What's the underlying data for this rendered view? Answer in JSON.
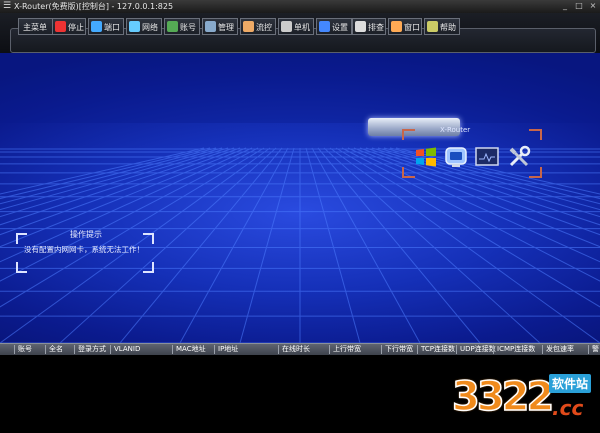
{
  "window": {
    "title": "X-Router(免费版)[控制台] - 127.0.0.1:825",
    "menu_icon": "menu-icon",
    "minimize_glyph": "_",
    "maximize_glyph": "□",
    "close_glyph": "×"
  },
  "toolbar": {
    "items": [
      {
        "label": "主菜单",
        "icon": "none"
      },
      {
        "label": "停止",
        "icon": "stop-icon"
      },
      {
        "label": "端口",
        "icon": "port-icon"
      },
      {
        "label": "网络",
        "icon": "network-icon"
      },
      {
        "label": "账号",
        "icon": "account-icon"
      },
      {
        "label": "管理",
        "icon": "manage-icon"
      },
      {
        "label": "流控",
        "icon": "flow-icon"
      },
      {
        "label": "单机",
        "icon": "host-icon"
      },
      {
        "label": "设置",
        "icon": "settings-icon"
      },
      {
        "label": "排查",
        "icon": "check-icon"
      },
      {
        "label": "窗口",
        "icon": "window-icon"
      },
      {
        "label": "帮助",
        "icon": "help-icon"
      }
    ]
  },
  "scene": {
    "device_label": "X-Router",
    "apps": [
      "windows-icon",
      "monitor-icon",
      "terminal-icon",
      "tools-icon"
    ]
  },
  "tip": {
    "title": "操作提示",
    "text": "没有配置内网网卡，系统无法工作！"
  },
  "table": {
    "columns": [
      "账号",
      "全名",
      "登录方式",
      "VLANID",
      "MAC地址",
      "IP地址",
      "在线时长",
      "上行带宽",
      "下行带宽",
      "TCP连接数",
      "UDP连接数",
      "ICMP连接数",
      "发包速率",
      "警"
    ]
  },
  "watermark": {
    "number": "3322",
    "site": "软件站",
    "domain": ".cc"
  },
  "colors": {
    "background": "#0b1b8f",
    "accent_frame": "#c8664a",
    "watermark_orange": "#f08a1c",
    "watermark_blue": "#2aa0d8"
  }
}
